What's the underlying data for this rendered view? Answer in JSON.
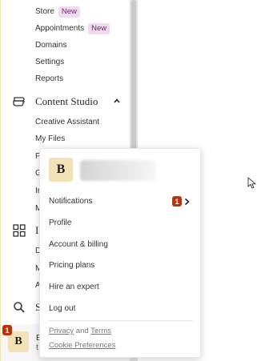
{
  "sidebar": {
    "store": {
      "label": "Store",
      "badge": "New"
    },
    "appointments": {
      "label": "Appointments",
      "badge": "New"
    },
    "domains": "Domains",
    "settings": "Settings",
    "reports": "Reports",
    "content_studio": {
      "label": "Content Studio",
      "icon": "content-studio-icon"
    },
    "creative_assistant": "Creative Assistant",
    "my_files": "My Files",
    "partial_items": [
      "P",
      "G",
      "In",
      "M"
    ],
    "second_section": {
      "label_partial": "I",
      "icon": "grid-icon"
    },
    "second_partial_items": [
      "D",
      "M",
      "A"
    ],
    "search": {
      "label_partial": "S",
      "icon": "search-icon"
    },
    "account": {
      "avatar_letter": "B",
      "notification_count": "1",
      "name_partial": "E",
      "subtitle_partial": "t"
    }
  },
  "account_menu": {
    "avatar_letter": "B",
    "items": [
      {
        "label": "Notifications",
        "badge": "1",
        "has_chevron": true
      },
      {
        "label": "Profile"
      },
      {
        "label": "Account & billing"
      },
      {
        "label": "Pricing plans"
      },
      {
        "label": "Hire an expert"
      },
      {
        "label": "Log out"
      }
    ],
    "legal": {
      "privacy": "Privacy",
      "and": "and",
      "terms": "Terms"
    },
    "cookie": "Cookie Preferences"
  },
  "colors": {
    "new_badge_bg": "#f1d9f0",
    "count_badge_bg": "#b8330e",
    "avatar_bg": "#f2e2b6"
  }
}
